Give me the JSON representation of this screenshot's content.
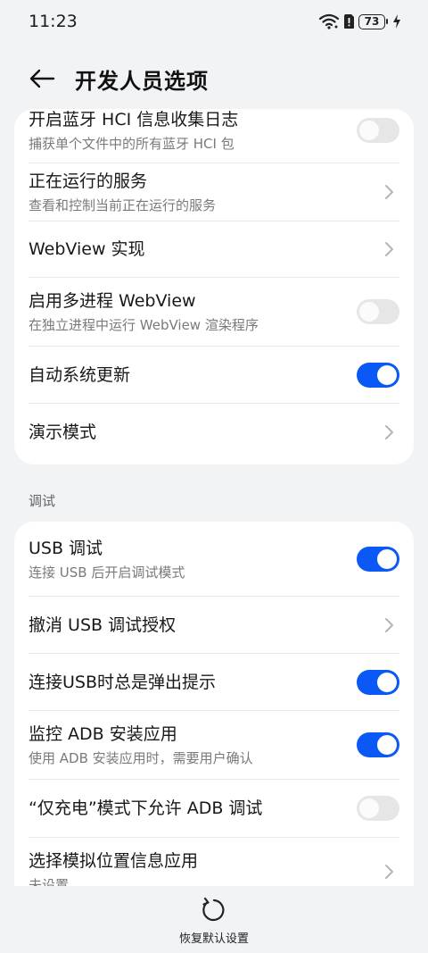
{
  "status_bar": {
    "time": "11:23",
    "battery": "73",
    "icons": [
      "wifi-icon",
      "sim-alert-icon",
      "battery-icon",
      "charging-icon"
    ]
  },
  "header": {
    "title": "开发人员选项",
    "back_icon": "back-arrow-icon"
  },
  "card1": {
    "items": [
      {
        "title": "开启蓝牙 HCI 信息收集日志",
        "subtitle": "捕获单个文件中的所有蓝牙 HCI 包",
        "control": "toggle",
        "on": false
      },
      {
        "title": "正在运行的服务",
        "subtitle": "查看和控制当前正在运行的服务",
        "control": "chevron"
      },
      {
        "title": "WebView 实现",
        "control": "chevron"
      },
      {
        "title": "启用多进程 WebView",
        "subtitle": "在独立进程中运行 WebView 渲染程序",
        "control": "toggle",
        "on": false
      },
      {
        "title": "自动系统更新",
        "control": "toggle",
        "on": true
      },
      {
        "title": "演示模式",
        "control": "chevron"
      }
    ]
  },
  "section_debug": {
    "label": "调试"
  },
  "card2": {
    "items": [
      {
        "title": "USB 调试",
        "subtitle": "连接 USB 后开启调试模式",
        "control": "toggle",
        "on": true
      },
      {
        "title": "撤消 USB 调试授权",
        "control": "chevron"
      },
      {
        "title": "连接USB时总是弹出提示",
        "control": "toggle",
        "on": true
      },
      {
        "title": "监控 ADB 安装应用",
        "subtitle": "使用 ADB 安装应用时，需要用户确认",
        "control": "toggle",
        "on": true
      },
      {
        "title": "“仅充电”模式下允许 ADB 调试",
        "control": "toggle",
        "on": false
      },
      {
        "title": "选择模拟位置信息应用",
        "subtitle": "未设置",
        "control": "chevron"
      }
    ]
  },
  "bottom": {
    "label": "恢复默认设置",
    "icon": "restore-icon"
  },
  "colors": {
    "accent": "#0a59f7",
    "background": "#f1f3f5",
    "card": "#ffffff",
    "toggle_off": "#e6e6e6"
  }
}
